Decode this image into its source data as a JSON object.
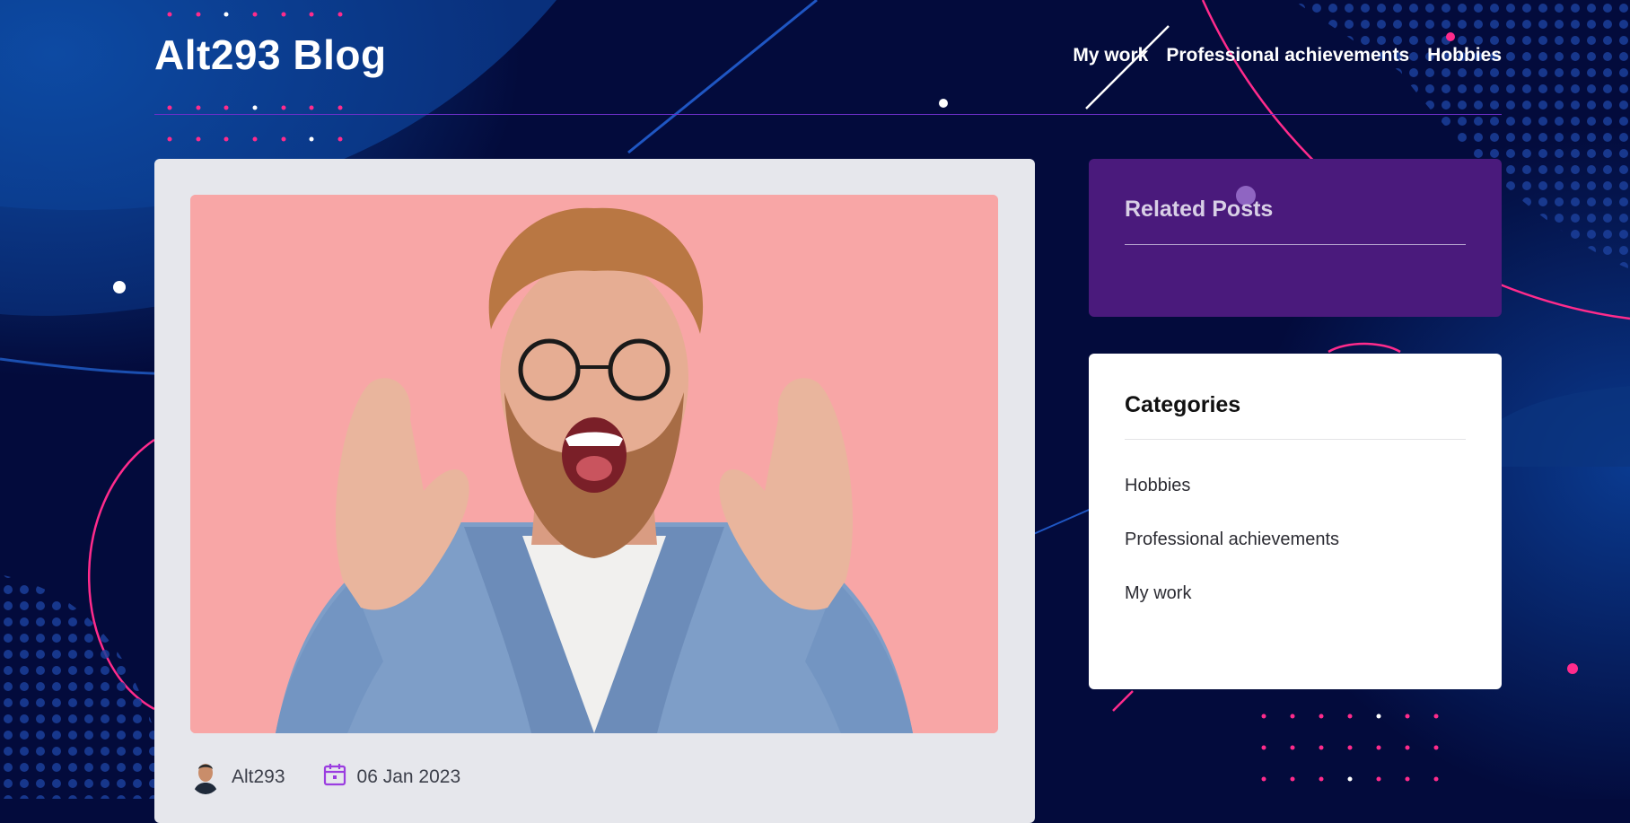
{
  "site": {
    "brand": "Alt293 Blog"
  },
  "nav": {
    "items": [
      "My work",
      "Professional achievements",
      "Hobbies"
    ]
  },
  "post": {
    "image_alt": "Angry man with glasses and curly hair shouting",
    "author": "Alt293",
    "date": "06 Jan 2023"
  },
  "sidebar": {
    "related_title": "Related Posts",
    "categories_title": "Categories",
    "categories": [
      "Hobbies",
      "Professional achievements",
      "My work"
    ]
  },
  "colors": {
    "background": "#030b3c",
    "accent_pink": "#ff2b8c",
    "related_panel": "#4a1a7c",
    "card": "#e6e7ec",
    "calendar_icon": "#9b3de0"
  }
}
